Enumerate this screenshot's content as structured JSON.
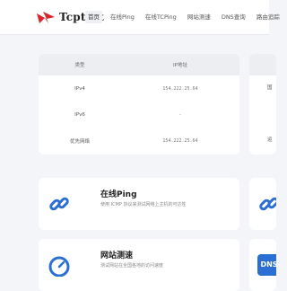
{
  "brand": {
    "name": "Tcptest",
    "logo_icon": "mosquito-logo-icon",
    "accent": "#d9262c"
  },
  "nav": {
    "items": [
      {
        "label": "首页",
        "active": true
      },
      {
        "label": "在线Ping",
        "active": false
      },
      {
        "label": "在线TCPing",
        "active": false
      },
      {
        "label": "网站测速",
        "active": false
      },
      {
        "label": "DNS查询",
        "active": false
      },
      {
        "label": "路由追踪",
        "active": false
      }
    ]
  },
  "ip_table": {
    "headers": {
      "type": "类型",
      "ip": "IP地址"
    },
    "rows": [
      {
        "type": "IPv4",
        "ip": "154.222.25.64"
      },
      {
        "type": "IPv6",
        "ip": "-"
      },
      {
        "type": "优先网络",
        "ip": "154.222.25.64"
      }
    ]
  },
  "side_table": {
    "cells": [
      "国",
      "",
      "运"
    ]
  },
  "tools": [
    {
      "title": "在线Ping",
      "desc": "使用 ICMP 协议来测试网络上主机的可达性",
      "icon": "link-icon"
    },
    {
      "title": "网站测速",
      "desc": "测试网站在全国各地的访问速度",
      "icon": "speed-gauge-icon"
    }
  ],
  "side_tools": [
    {
      "icon": "link-icon"
    },
    {
      "label": "DNS",
      "icon": "dns-icon"
    }
  ],
  "colors": {
    "icon_blue": "#2a6fd1",
    "background": "#f3f5f8"
  }
}
